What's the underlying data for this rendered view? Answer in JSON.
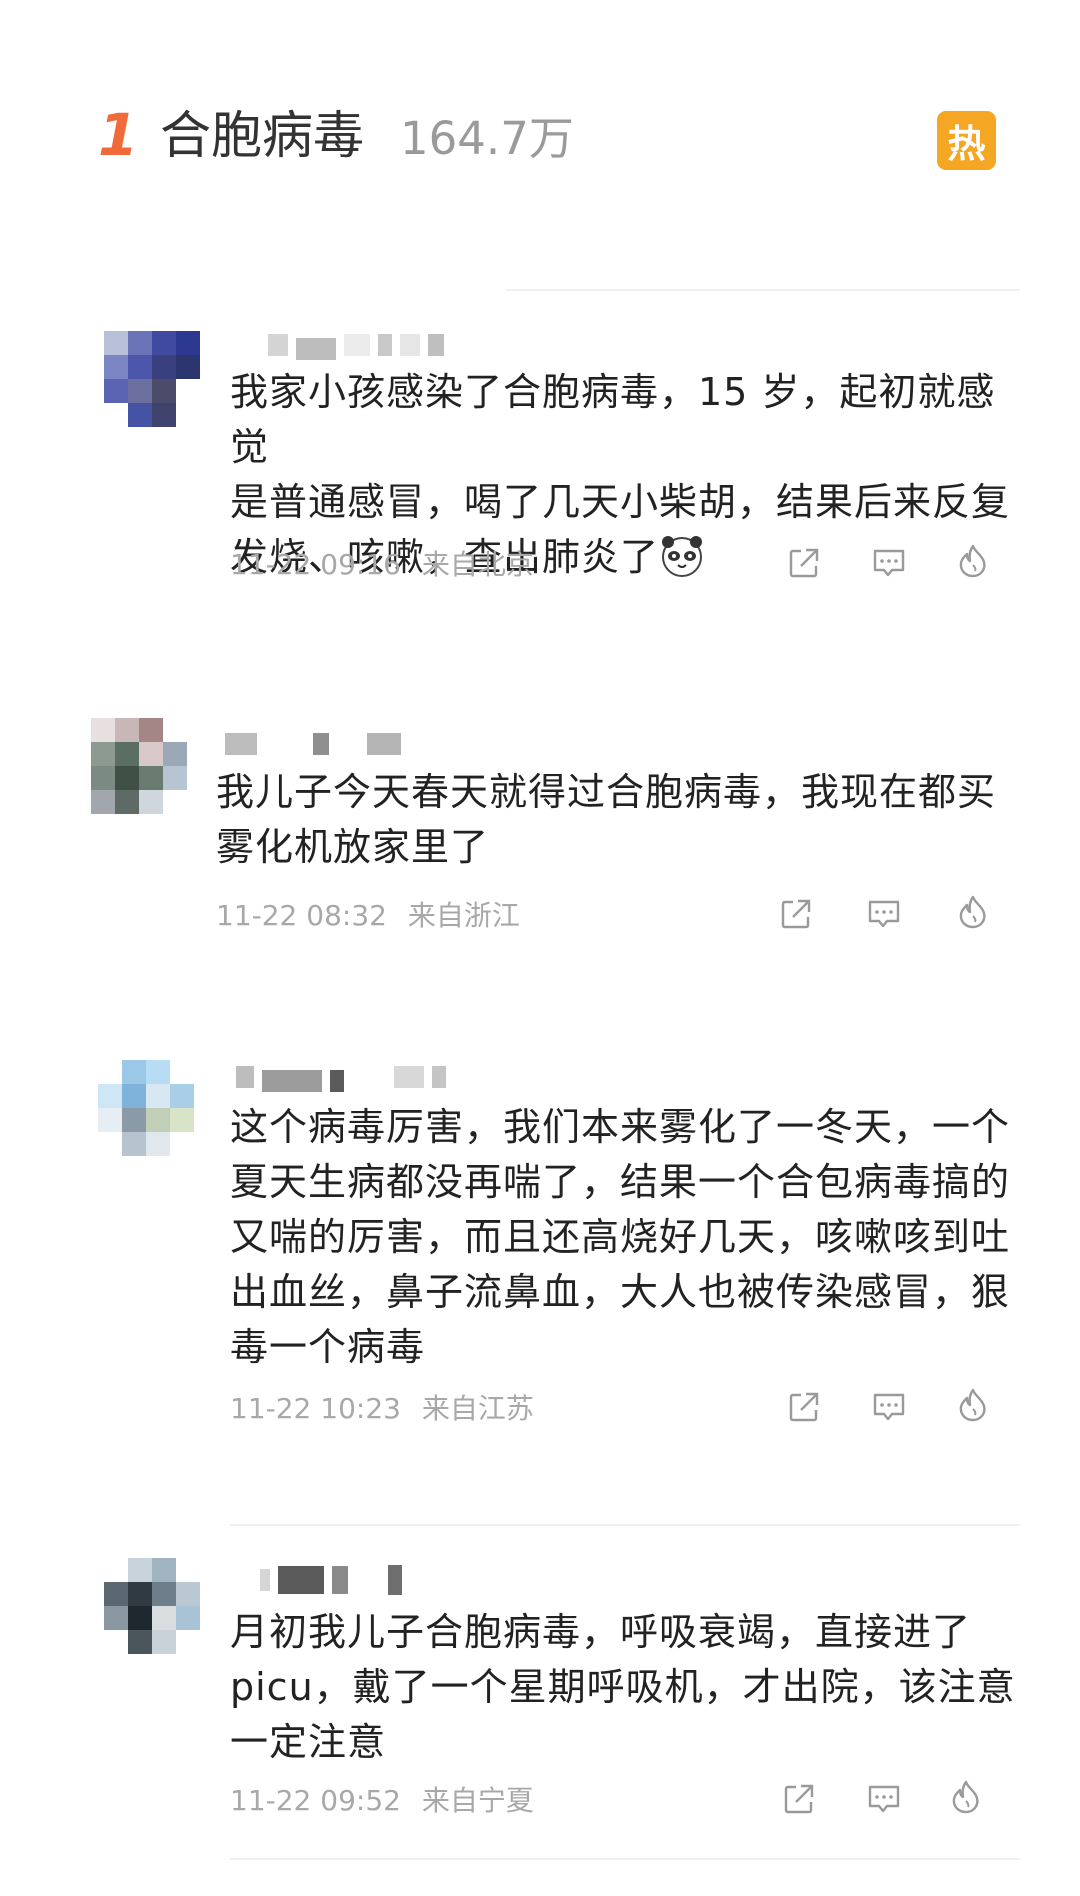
{
  "hot_topic": {
    "rank": "1",
    "title": "合胞病毒",
    "count": "164.7万",
    "badge": "热",
    "badge_color": "#f5a623",
    "rank_color": "#f06a3a"
  },
  "comments": [
    {
      "lines": [
        "我家小孩感染了合胞病毒，15 岁，起初就感觉",
        "是普通感冒，喝了几天小柴胡，结果后来反复",
        "发烧、咳嗽，查出肺炎了"
      ],
      "emoji": "panda-emoji",
      "time": "11-22 09:16",
      "location": "来自北京"
    },
    {
      "lines": [
        "我儿子今天春天就得过合胞病毒，我现在都买",
        "雾化机放家里了"
      ],
      "time": "11-22 08:32",
      "location": "来自浙江"
    },
    {
      "lines": [
        "这个病毒厉害，我们本来雾化了一冬天，一个",
        "夏天生病都没再喘了，结果一个合包病毒搞的",
        "又喘的厉害，而且还高烧好几天，咳嗽咳到吐",
        "出血丝，鼻子流鼻血，大人也被传染感冒，狠",
        "毒一个病毒"
      ],
      "time": "11-22 10:23",
      "location": "来自江苏"
    },
    {
      "lines": [
        "月初我儿子合胞病毒，呼吸衰竭，直接进了",
        "picu，戴了一个星期呼吸机，才出院，该注意",
        "一定注意"
      ],
      "time": "11-22 09:52",
      "location": "来自宁夏"
    }
  ],
  "action_icons": [
    "share-icon",
    "comment-icon",
    "like-flame-icon"
  ]
}
